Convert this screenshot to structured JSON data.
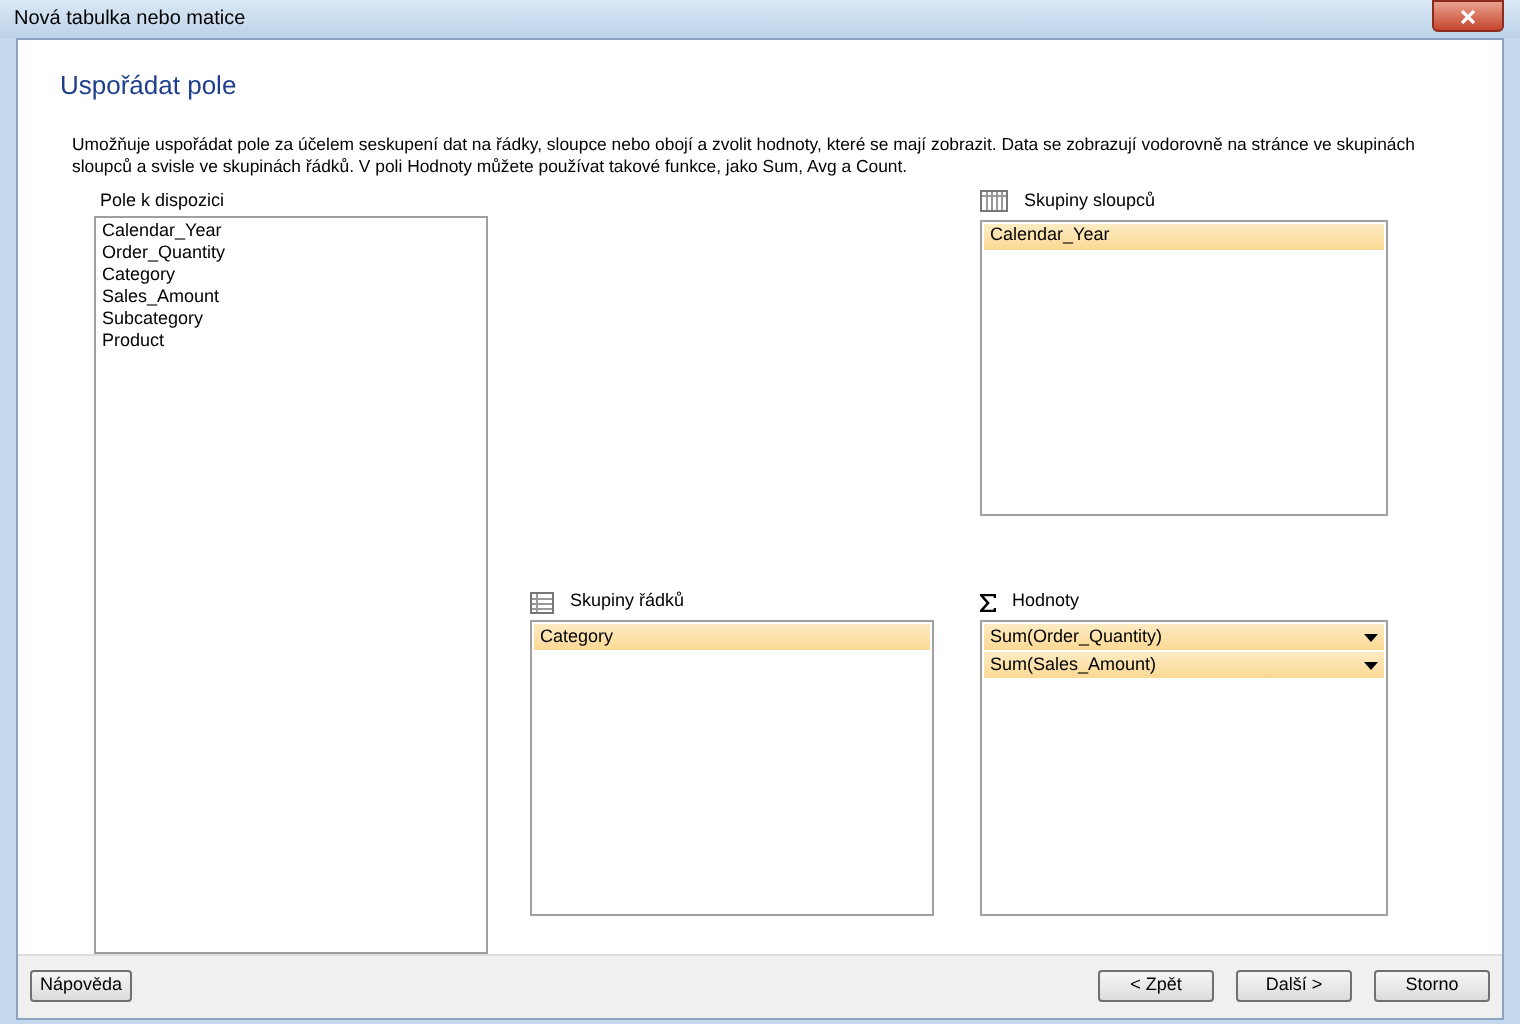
{
  "window": {
    "title": "Nová tabulka nebo matice"
  },
  "heading": "Uspořádat pole",
  "description": "Umožňuje uspořádat pole za účelem seskupení dat na řádky, sloupce nebo obojí a zvolit hodnoty, které se mají zobrazit. Data se zobrazují vodorovně na stránce ve skupinách sloupců a svisle ve skupinách řádků. V poli Hodnoty můžete používat takové funkce, jako Sum, Avg a Count.",
  "available_fields": {
    "label": "Pole k dispozici",
    "items": [
      "Calendar_Year",
      "Order_Quantity",
      "Category",
      "Sales_Amount",
      "Subcategory",
      "Product"
    ]
  },
  "column_groups": {
    "label": "Skupiny sloupců",
    "items": [
      "Calendar_Year"
    ]
  },
  "row_groups": {
    "label": "Skupiny řádků",
    "items": [
      "Category"
    ]
  },
  "values": {
    "label": "Hodnoty",
    "items": [
      "Sum(Order_Quantity)",
      "Sum(Sales_Amount)"
    ]
  },
  "help_button": "Nápověda",
  "nav_buttons": [
    "< Zpět",
    "Další >",
    "Storno"
  ]
}
